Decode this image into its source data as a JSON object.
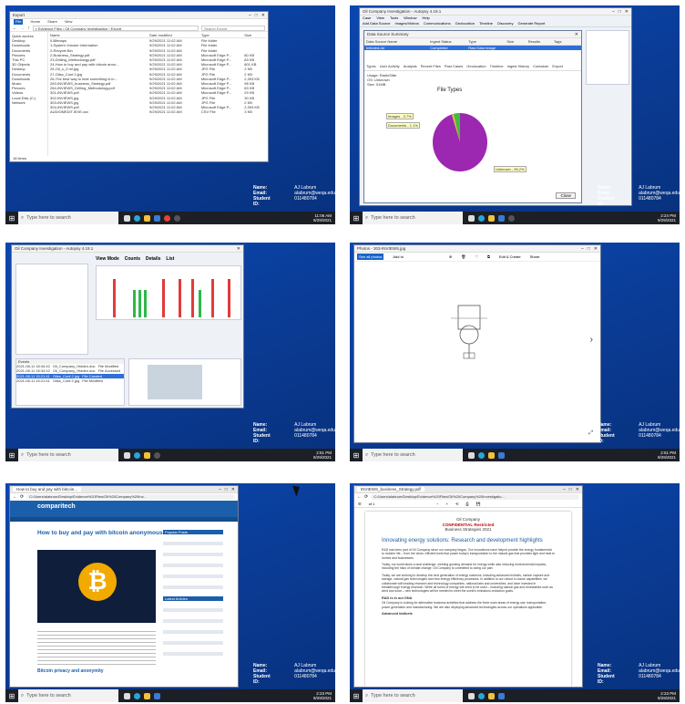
{
  "common": {
    "search_placeholder": "Type here to search",
    "student": {
      "name_label": "Name:",
      "email_label": "Email:",
      "id_label": "Student ID:",
      "name": "AJ Labrum",
      "email": "alabrum@weqa.edu",
      "id": "011480784"
    }
  },
  "tiles": [
    {
      "clock_time": "11:06 AM",
      "clock_date": "9/29/2021",
      "explorer": {
        "title": "Export",
        "menu": [
          "File",
          "Home",
          "Share",
          "View"
        ],
        "path": "« Evidence Files › Oil Company Investigation › Export",
        "search": "Search Export",
        "nav": [
          "Quick access",
          "Desktop",
          "Downloads",
          "Documents",
          "Pictures",
          "This PC",
          "3D Objects",
          "Desktop",
          "Documents",
          "Downloads",
          "Music",
          "Pictures",
          "Videos",
          "Local Disk (C:)",
          "Network"
        ],
        "columns": [
          "Name",
          "Date modified",
          "Type",
          "Size"
        ],
        "files": [
          [
            "0-Bitmaps",
            "9/29/2021 11:02 AM",
            "File folder",
            ""
          ],
          [
            "1-System Volume Information",
            "9/29/2021 11:02 AM",
            "File folder",
            ""
          ],
          [
            "2-Recycle.Bin",
            "9/29/2021 11:02 AM",
            "File folder",
            ""
          ],
          [
            "2-Business_Strategy.pdf",
            "9/29/2021 11:02 AM",
            "Microsoft Edge P...",
            "80 KB"
          ],
          [
            "23-Drilling_Methodology.pdf",
            "9/29/2021 11:02 AM",
            "Microsoft Edge P...",
            "83 KB"
          ],
          [
            "24-How to buy and pay with bitcoin anon...",
            "9/29/2021 11:02 AM",
            "Microsoft Edge P...",
            "801 KB"
          ],
          [
            "25-Oil_s_2.hrl.jpg",
            "9/29/2021 11:02 AM",
            "JPG File",
            "2 KB"
          ],
          [
            "27-Oilss_Conf.2.jpg",
            "9/29/2021 11:02 AM",
            "JPG File",
            "2 KB"
          ],
          [
            "26-The best way to hide something is in...",
            "9/29/2021 11:02 AM",
            "Microsoft Edge P...",
            "2,393 KB"
          ],
          [
            "283-INVIEWS_business_Strategy.pdf",
            "9/29/2021 11:02 AM",
            "Microsoft Edge P...",
            "98 KB"
          ],
          [
            "284-INVIEWS_Drilling_Methodology.pdf",
            "9/29/2021 11:02 AM",
            "Microsoft Edge P...",
            "83 KB"
          ],
          [
            "301-INVIEWS.pdf",
            "9/29/2021 11:02 AM",
            "Microsoft Edge P...",
            "29 KB"
          ],
          [
            "302-INVIEWS.jpg",
            "9/29/2021 11:02 AM",
            "JPG File",
            "30 KB"
          ],
          [
            "303-INVIEWS.jpg",
            "9/29/2021 11:02 AM",
            "JPG File",
            "2 KB"
          ],
          [
            "304-INVIEWS.pdf",
            "9/29/2021 11:02 AM",
            "Microsoft Edge P...",
            "2,393 KB"
          ],
          [
            "AUDIOMEDIT.IEXE.csv",
            "9/29/2021 11:02 AM",
            "CSV File",
            "3 KB"
          ]
        ],
        "status": "16 items"
      }
    },
    {
      "clock_time": "2:24 PM",
      "clock_date": "9/29/2021",
      "autopsy": {
        "title": "Oil Company Investigation - Autopsy 4.19.1",
        "menu": [
          "Case",
          "View",
          "Tools",
          "Window",
          "Help"
        ],
        "toolbar": [
          "Add Data Source",
          "Images/Videos",
          "Communications",
          "Geolocation",
          "Timeline",
          "Discovery",
          "Generate Report"
        ],
        "summary_title": "Data Source Summary",
        "ds_cols": [
          "Data Source Name",
          "Ingest Status",
          "Type",
          "Size",
          "Results",
          "Tags"
        ],
        "ds_row": [
          "Infected.dd",
          "Completed",
          "Raw Data Image",
          "",
          "",
          ""
        ],
        "tabs": [
          "Types",
          "User Activity",
          "Analysis",
          "Recent Files",
          "Past Cases",
          "Geolocation",
          "Timeline",
          "Ingest History",
          "Container",
          "Export"
        ],
        "info": [
          "Usage: RadioSitte",
          "OS: Unknown",
          "Size: 51MB"
        ],
        "chart_title": "File Types",
        "pie_labels": [
          "Images - 3.7%",
          "Documents - 1.1%",
          "Unknown - 95.2%"
        ],
        "close": "Close"
      }
    },
    {
      "clock_time": "2:51 PM",
      "clock_date": "9/29/2021",
      "timeline": {
        "title": "Oil Company Investigation - Autopsy 4.19.1",
        "modes": [
          "View Mode",
          "Counts",
          "Details",
          "List"
        ],
        "events_label": "Events",
        "event_rows": [
          [
            "2021-08-11 18:34:42",
            "Oil_Company_Hidden.doc",
            "File Modified"
          ],
          [
            "2021-08-11 18:34:42",
            "Oil_Company_Hidden.doc",
            "File Accessed"
          ],
          [
            "2021-08-11 15:21:41",
            "Oilss_Conf.2.jpg",
            "File Created"
          ],
          [
            "2021-08-11 15:21:41",
            "Oilss_Conf.2.jpg",
            "File Modified"
          ]
        ]
      }
    },
    {
      "clock_time": "2:51 PM",
      "clock_date": "9/29/2021",
      "photos": {
        "title": "Photos - 303-INVIEWS.jpg",
        "actions": [
          "See all photos",
          "Add to",
          "Edit & Create",
          "Share"
        ]
      }
    },
    {
      "clock_time": "2:23 PM",
      "clock_date": "9/29/2021",
      "browser": {
        "tab": "How to buy and pay with bitcoin...",
        "url": "C:/Users/alabrum/Desktop/Evidence%20Files/Oil%20Company%20Inv...",
        "site": "comparitech",
        "headline": "How to buy and pay with bitcoin anonymously",
        "section": "Bitcoin privacy and anonymity",
        "side_heads": [
          "Popular Posts",
          "Latest Articles"
        ]
      }
    },
    {
      "clock_time": "2:23 PM",
      "clock_date": "9/29/2021",
      "pdf": {
        "tab": "INVIEWS_business_Strategy.pdf",
        "url": "C:/Users/alabrum/Desktop/Evidence%20Files/Oil%20Company%20Investigatio...",
        "page": "of 1",
        "company": "Oil Company",
        "confidential": "CONFIDENTIAL Restricted",
        "doc_title": "Business Strategies 2021",
        "heading": "Innovating energy solutions: Research and development highlights",
        "para1": "R&D has been part of Oil Company since our company began. Our innovations have helped provide the energy fundamental to modern life – from the clean, efficient fuels that power today's transportation to the natural gas that provides light and heat to homes and businesses.",
        "para2": "Today, our world faces a dual challenge: meeting growing demand for energy while also reducing environmental impacts, including the risks of climate change. Oil Company is committed to doing our part.",
        "para3": "Today, we are working to develop the next generation of energy solutions, including advanced biofuels, carbon capture and storage, natural gas technologies and new energy efficiency processes. In addition to our robust in-house capabilities, we collaborate with leading research and technology companies, national labs and universities, and have invested in breakthrough energy research. While all forms of energy will need to be used – including natural gas and renewables such as wind and solar – new technologies will be needed to meet the world's emissions-reduction goals.",
        "sub1": "R&D is in our DNA",
        "para4": "Oil Company is looking for alternative business activities that address the three main areas of energy use: transportation, power generation and manufacturing. We are also deploying advanced technologies across our operations applicable.",
        "sub2": "Advanced biofuels"
      }
    }
  ]
}
